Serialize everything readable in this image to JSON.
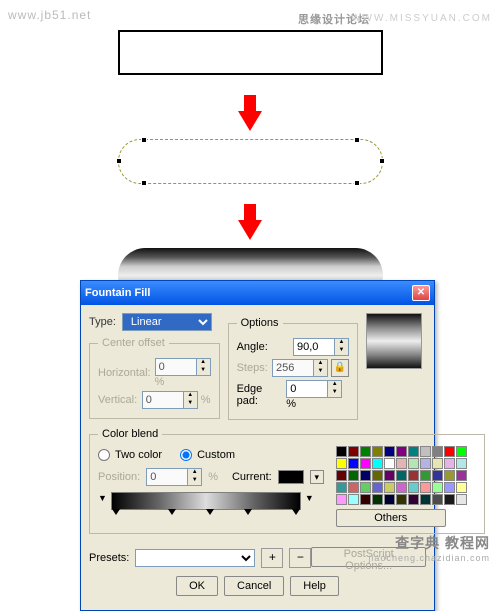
{
  "watermarks": {
    "jb51": "www.jb51.net",
    "forum_cn": "思缘设计论坛",
    "missyuan": "WWW.MISSYUAN.COM",
    "chazidian_cn": "查字典 教程网",
    "chazidian_en": "jiaocheng.chazidian.com"
  },
  "dialog": {
    "title": "Fountain Fill",
    "type_label": "Type:",
    "type_value": "Linear",
    "center_offset": {
      "legend": "Center offset",
      "horizontal_label": "Horizontal:",
      "horizontal_value": "0",
      "horizontal_suffix": "%",
      "vertical_label": "Vertical:",
      "vertical_value": "0",
      "vertical_suffix": "%"
    },
    "options": {
      "legend": "Options",
      "angle_label": "Angle:",
      "angle_value": "90,0",
      "steps_label": "Steps:",
      "steps_value": "256",
      "edgepad_label": "Edge pad:",
      "edgepad_value": "0",
      "edgepad_suffix": "%"
    },
    "color_blend": {
      "legend": "Color blend",
      "two_color": "Two color",
      "custom": "Custom",
      "position_label": "Position:",
      "position_value": "0",
      "position_suffix": "%",
      "current_label": "Current:",
      "others": "Others"
    },
    "presets_label": "Presets:",
    "postscript": "PostScript Options...",
    "buttons": {
      "ok": "OK",
      "cancel": "Cancel",
      "help": "Help"
    }
  },
  "palette_colors": [
    "#000000",
    "#800000",
    "#008000",
    "#808000",
    "#000080",
    "#800080",
    "#008080",
    "#c0c0c0",
    "#808080",
    "#ff0000",
    "#00ff00",
    "#ffff00",
    "#0000ff",
    "#ff00ff",
    "#00ffff",
    "#ffffff",
    "#e6b3b3",
    "#b3e6b3",
    "#b3b3e6",
    "#e6e6b3",
    "#e6b3e6",
    "#b3e6e6",
    "#660000",
    "#006600",
    "#000066",
    "#666600",
    "#660066",
    "#006666",
    "#993333",
    "#339933",
    "#333399",
    "#999933",
    "#993399",
    "#339999",
    "#cc6666",
    "#66cc66",
    "#6666cc",
    "#cccc66",
    "#cc66cc",
    "#66cccc",
    "#ff9999",
    "#99ff99",
    "#9999ff",
    "#ffff99",
    "#ff99ff",
    "#99ffff",
    "#330000",
    "#003300",
    "#000033",
    "#333300",
    "#330033",
    "#003333",
    "#4d4d4d",
    "#1a1a1a",
    "#e6e6e6"
  ]
}
